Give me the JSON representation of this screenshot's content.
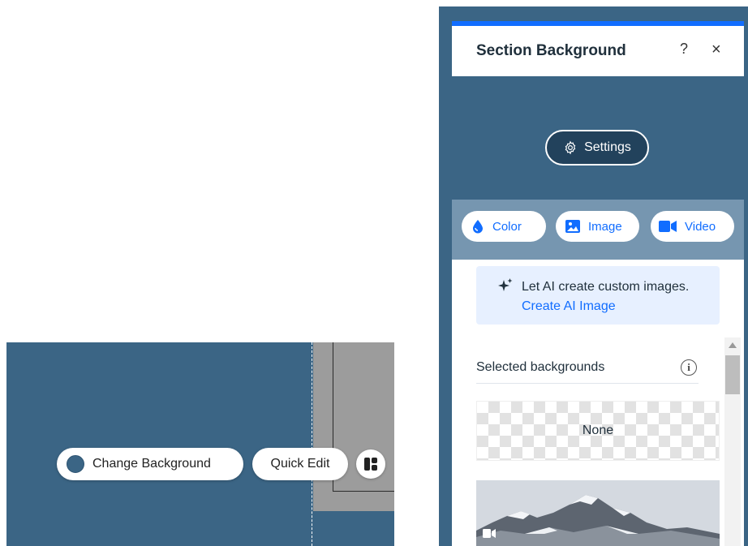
{
  "canvas": {
    "change_background_label": "Change Background",
    "quick_edit_label": "Quick Edit",
    "section_color": "#3b6585"
  },
  "panel": {
    "title": "Section Background",
    "help_label": "?",
    "close_label": "×",
    "settings_label": "Settings",
    "types": [
      {
        "label": "Color",
        "icon": "drop-icon"
      },
      {
        "label": "Image",
        "icon": "image-icon"
      },
      {
        "label": "Video",
        "icon": "video-camera-icon"
      }
    ],
    "ai": {
      "text": "Let AI create custom images.",
      "link": "Create AI Image"
    },
    "selected_backgrounds_label": "Selected backgrounds",
    "info_label": "i",
    "none_label": "None",
    "accent_color": "#116dff"
  }
}
